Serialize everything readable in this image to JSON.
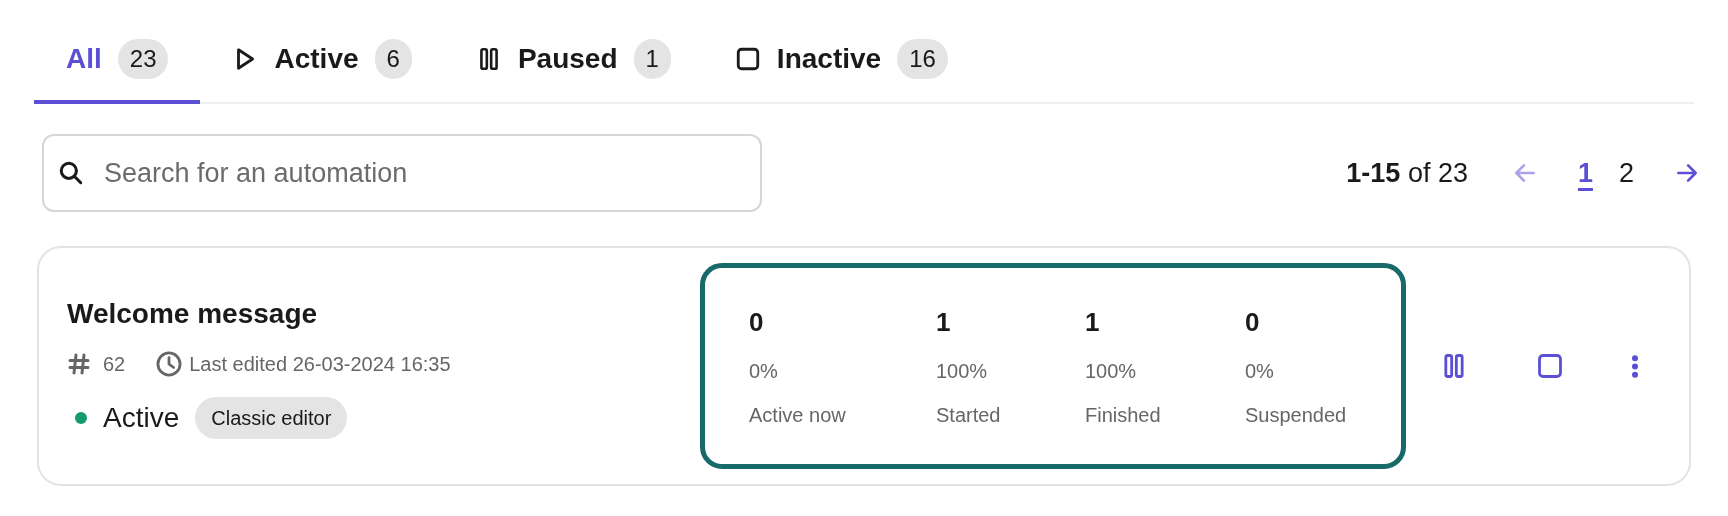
{
  "tabs": [
    {
      "label": "All",
      "count": "23",
      "kind": "none",
      "selected": true
    },
    {
      "label": "Active",
      "count": "6",
      "kind": "play",
      "selected": false
    },
    {
      "label": "Paused",
      "count": "1",
      "kind": "pause",
      "selected": false
    },
    {
      "label": "Inactive",
      "count": "16",
      "kind": "stop",
      "selected": false
    }
  ],
  "search": {
    "placeholder": "Search for an automation"
  },
  "pagination": {
    "range": "**1-15** of 23",
    "pages": [
      {
        "label": "1",
        "selected": true
      },
      {
        "label": "2",
        "selected": false
      }
    ],
    "previous_disabled": true,
    "next_disabled": false
  },
  "automations": [
    {
      "title": "Welcome message",
      "id_number": "62",
      "last_edited": "Last edited 26-03-2024 16:35",
      "status": "Active",
      "color": "#169b6b",
      "editor": "Classic editor",
      "highlighted": true,
      "stats": [
        {
          "value": "0",
          "percent": "0%",
          "label": "Active now"
        },
        {
          "value": "1",
          "percent": "100%",
          "label": "Started"
        },
        {
          "value": "1",
          "percent": "100%",
          "label": "Finished"
        },
        {
          "value": "0",
          "percent": "0%",
          "label": "Suspended"
        }
      ]
    }
  ]
}
